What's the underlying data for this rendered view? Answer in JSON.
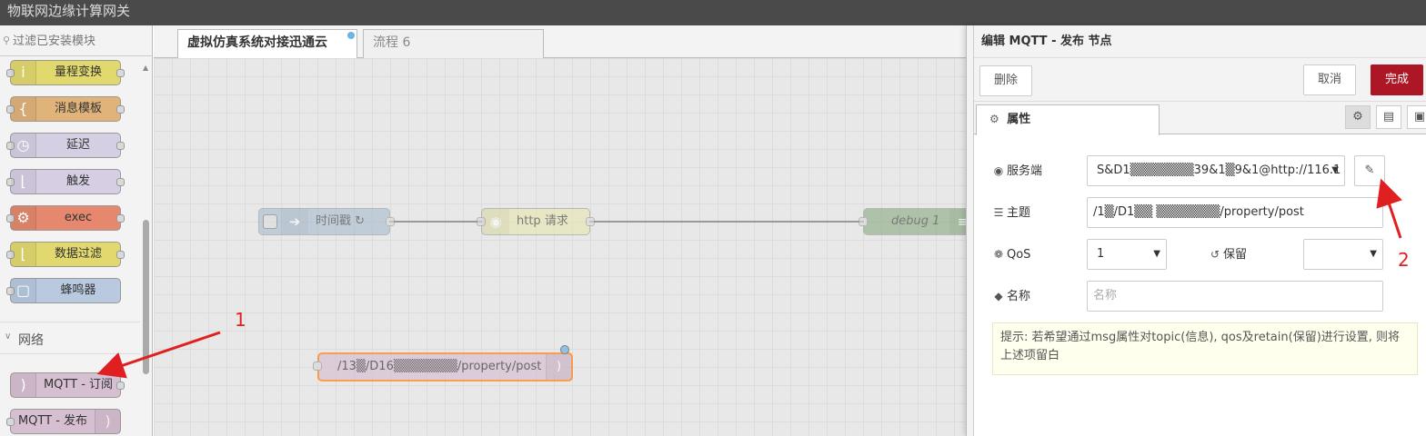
{
  "window": {
    "title": "物联网边缘计算网关"
  },
  "palette": {
    "search_placeholder": "过滤已安装模块",
    "nodes": [
      {
        "label": "量程变换",
        "color": "#e2d96e",
        "icon": "range-icon"
      },
      {
        "label": "消息模板",
        "color": "#e0b37a",
        "icon": "template-icon"
      },
      {
        "label": "延迟",
        "color": "#d6cfe4",
        "icon": "delay-icon"
      },
      {
        "label": "触发",
        "color": "#d6cfe4",
        "icon": "trigger-icon"
      },
      {
        "label": "exec",
        "color": "#e5886d",
        "icon": "gear-icon"
      },
      {
        "label": "数据过滤",
        "color": "#e2d96e",
        "icon": "filter-icon"
      },
      {
        "label": "蜂鸣器",
        "color": "#b8c9e0",
        "icon": "file-icon"
      }
    ],
    "category": "网络",
    "network_nodes": [
      {
        "label": "MQTT - 订阅",
        "color": "#d7bfd2",
        "icon": "wifi-icon"
      },
      {
        "label": "MQTT - 发布",
        "color": "#d7bfd2",
        "icon": "wifi-icon"
      }
    ]
  },
  "tabs": [
    {
      "label": "虚拟仿真系统对接迅通云",
      "active": true
    },
    {
      "label": "流程 6",
      "active": false
    }
  ],
  "workspace": {
    "nodes": [
      {
        "label": "时间戳 ↻",
        "color": "#a6bbcf"
      },
      {
        "label": "http 请求",
        "color": "#e7e7ae"
      },
      {
        "label": "debug 1",
        "color": "#87a980"
      }
    ],
    "mqtt_node_label": "/13▒/D16▒▒▒▒▒▒▒/property/post"
  },
  "editor": {
    "header": "编辑 MQTT - 发布 节点",
    "delete_label": "删除",
    "cancel_label": "取消",
    "done_label": "完成",
    "properties_tab": "属性",
    "server_label": "服务端",
    "server_value": "S&D1▒▒▒▒▒▒▒39&1▒9&1@http://116.1",
    "topic_label": "主题",
    "topic_value": "/1▒/D1▒▒ ▒▒▒▒▒▒▒/property/post",
    "qos_label": "QoS",
    "qos_value": "1",
    "retain_label": "保留",
    "retain_value": "",
    "name_label": "名称",
    "name_placeholder": "名称",
    "tip_text": "提示: 若希望通过msg属性对topic(信息), qos及retain(保留)进行设置, 则将上述项留白"
  },
  "annotations": {
    "first": "1",
    "second": "2"
  },
  "colors": {
    "done_button": "#ad1625",
    "annotation": "#e02020",
    "selected_outline": "#ff7f0e",
    "status_dot": "#6cb4e4"
  }
}
